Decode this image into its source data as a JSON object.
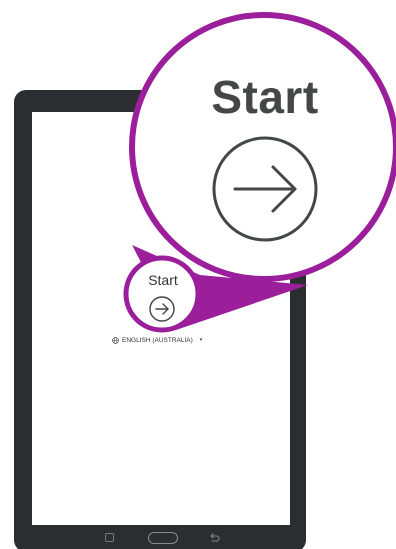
{
  "screen": {
    "start_label": "Start",
    "language_label": "ENGLISH (AUSTRALIA)",
    "language_caret": "▾",
    "arrow_icon": "arrow-right-circle-icon",
    "globe_icon": "globe-icon"
  },
  "magnifier": {
    "start_label": "Start",
    "arrow_icon": "arrow-right-circle-icon",
    "ring_color": "#9b1f9b"
  },
  "navbar": {
    "recent_icon": "recent-apps-icon",
    "home_icon": "home-button-icon",
    "back_icon": "back-icon"
  },
  "colors": {
    "tablet_frame": "#2b2d30",
    "highlight": "#9b1f9b",
    "text": "#444648"
  }
}
